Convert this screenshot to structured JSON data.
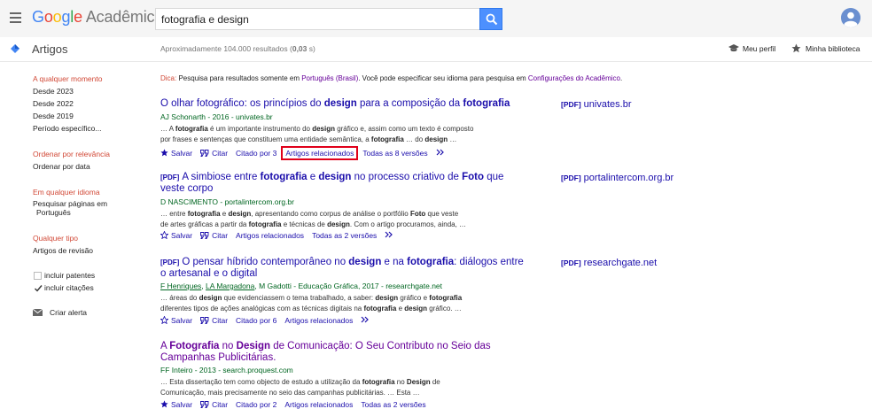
{
  "header": {
    "logo_google": [
      "G",
      "o",
      "o",
      "g",
      "l",
      "e"
    ],
    "logo_product": "Acadêmico",
    "search_value": "fotografia e design"
  },
  "subheader": {
    "section_title": "Artigos",
    "results_prefix": "Aproximadamente 104.000 resultados (",
    "results_time": "0,03",
    "results_suffix": " s)",
    "my_profile": "Meu perfil",
    "my_library": "Minha biblioteca"
  },
  "sidebar": {
    "time_heading": "A qualquer momento",
    "time_items": [
      "Desde 2023",
      "Desde 2022",
      "Desde 2019",
      "Período específico..."
    ],
    "sort_heading": "Ordenar por relevância",
    "sort_item": "Ordenar por data",
    "lang_heading": "Em qualquer idioma",
    "lang_item_line1": "Pesquisar páginas em",
    "lang_item_line2": "Português",
    "type_heading": "Qualquer tipo",
    "type_item": "Artigos de revisão",
    "include_patents": "incluir patentes",
    "include_citations": "incluir citações",
    "create_alert": "Criar alerta"
  },
  "notice": {
    "dica": "Dica:",
    "part1": " Pesquisa para resultados somente em ",
    "lang_link": "Português (Brasil)",
    "part2": ". Você pode especificar seu idioma para pesquisa em ",
    "settings_link": "Configurações do Acadêmico",
    "part3": "."
  },
  "actions": {
    "save": "Salvar",
    "cite": "Citar",
    "related": "Artigos relacionados"
  },
  "results": [
    {
      "meta": "AJ Schonarth - 2016 - univates.br",
      "snippet_line1_a": "… A ",
      "snippet_line1_b": "fotografia",
      "snippet_line1_c": " é um importante instrumento do ",
      "snippet_line1_d": "design",
      "snippet_line1_e": " gráfico e, assim como um texto é composto",
      "snippet_line2_a": "por frases e sentenças que constituem uma entidade semântica, a ",
      "snippet_line2_b": "fotografia",
      "snippet_line2_c": " … do ",
      "snippet_line2_d": "design",
      "snippet_line2_e": " …",
      "cited": "Citado por 3",
      "versions": "Todas as 8 versões",
      "side_pdf": "[PDF]",
      "side_source": "univates.br"
    },
    {
      "pdf_tag": "[PDF]",
      "meta": "D NASCIMENTO - portalintercom.org.br",
      "snippet_line1": "… entre fotografia e design, apresentando como corpus de análise o portfólio Foto que veste",
      "snippet_line2": "de artes gráficas a partir da fotografia e técnicas de design. Com o artigo procuramos, ainda, …",
      "versions": "Todas as 2 versões",
      "side_pdf": "[PDF]",
      "side_source": "portalintercom.org.br"
    },
    {
      "pdf_tag": "[PDF]",
      "meta_a1": "F Henriques",
      "meta_sep": ", ",
      "meta_a2": "LA Margadona",
      "meta_rest": ", M Gadotti - Educação Gráfica, 2017 - researchgate.net",
      "snippet_line1": "… áreas do design que evidenciassem o tema trabalhado, a saber: design gráfico e fotografia",
      "snippet_line2": "diferentes tipos de ações analógicas com as técnicas digitais na fotografia e design gráfico. …",
      "cited": "Citado por 6",
      "side_pdf": "[PDF]",
      "side_source": "researchgate.net"
    },
    {
      "meta": "FF Inteiro - 2013 - search.proquest.com",
      "snippet_line1": "… Esta dissertação tem como objecto de estudo a utilização da fotografia no Design de",
      "snippet_line2": "Comunicação, mais precisamente no seio das campanhas publicitárias. … Esta …",
      "cited": "Citado por 2",
      "versions": "Todas as 2 versões"
    }
  ]
}
